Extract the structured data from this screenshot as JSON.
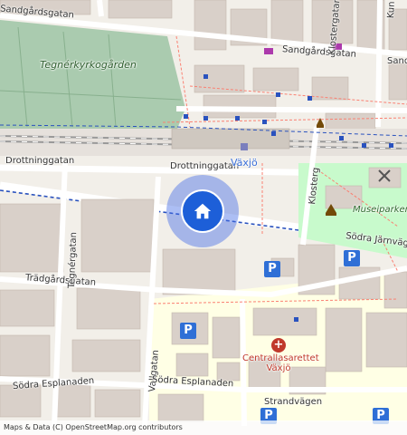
{
  "map": {
    "labels": {
      "sandgardsgatan_top": "Sandgårdsgatan",
      "sandgardsgatan_right": "Sandgårdsgatan",
      "sandgardsgatan_far": "Sand",
      "tegnerkyrkogarden": "Tegnérkyrkogården",
      "drottninggatan_left": "Drottninggatan",
      "drottninggatan_mid": "Drottninggatan",
      "vaxjo_station": "Växjö",
      "museiparken": "Museiparken",
      "sodra_jarnvagsgatan": "Södra Järnvägsg",
      "tradgardsgatan": "Trädgårdsgatan",
      "tegnergatan": "Tegnérgatan",
      "vallgatan": "Vallgatan",
      "sodra_esplanaden_left": "Södra Esplanaden",
      "sodra_esplanaden_mid": "Södra Esplanaden",
      "strandvagen": "Strandvägen",
      "kungsgatan": "Kun",
      "klostergatan": "Klostergatan",
      "klosterg_lower": "Klosterg",
      "hospital_line1": "Centrallasarettet",
      "hospital_line2": "Växjö",
      "parking_1": "P",
      "parking_2": "P",
      "parking_3": "P",
      "parking_4": "P",
      "parking_5": "P",
      "hospital_symbol": "+"
    },
    "attribution": "Maps & Data (C) OpenStreetMap.org contributors",
    "location_marker": {
      "icon": "home-icon",
      "color": "#1d5fd8"
    },
    "colors": {
      "background": "#f2efe9",
      "building": "#d9d0c9",
      "cemetery": "#aacbaf",
      "park": "#c8facc",
      "hospital_area": "#ffffe5",
      "railway": "#999999",
      "bus_route": "#2a52be",
      "footpath": "#fa8072"
    }
  }
}
